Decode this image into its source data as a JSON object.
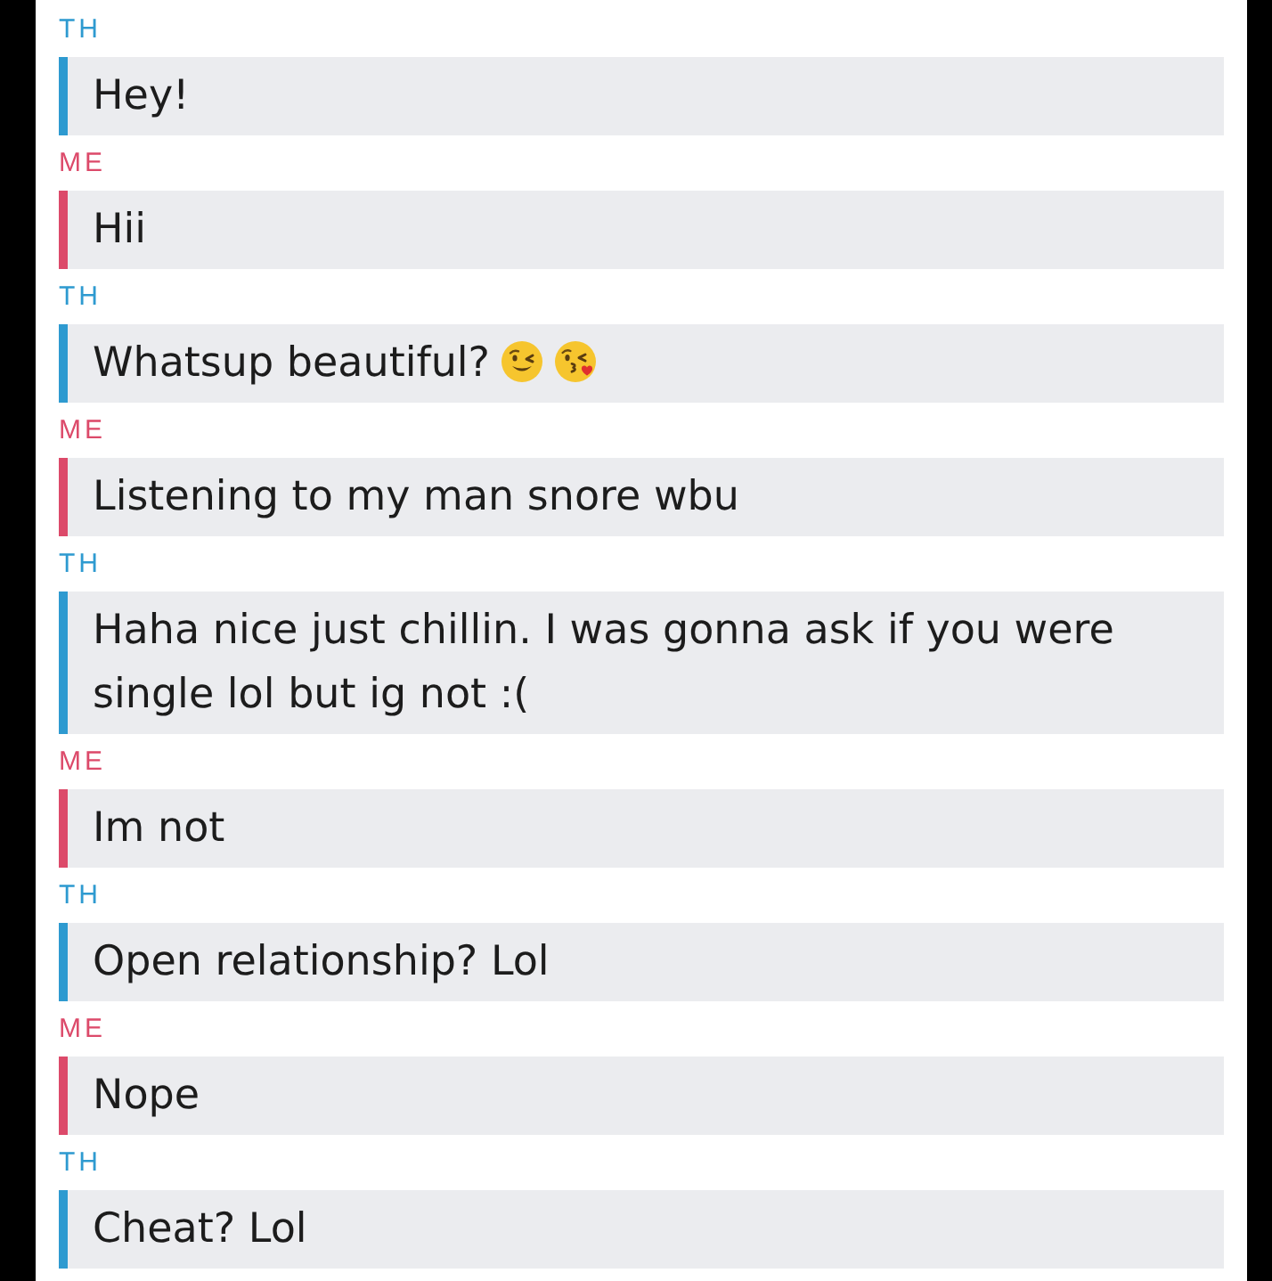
{
  "messages": [
    {
      "sender": "TH",
      "color": "#2e9ad0",
      "text": "Hey!"
    },
    {
      "sender": "ME",
      "color": "#dc4a6a",
      "text": "Hii"
    },
    {
      "sender": "TH",
      "color": "#2e9ad0",
      "text": "Whatsup beautiful?",
      "emojis": [
        {
          "kind": "wink"
        },
        {
          "kind": "kiss"
        }
      ]
    },
    {
      "sender": "ME",
      "color": "#dc4a6a",
      "text": "Listening to my man snore wbu"
    },
    {
      "sender": "TH",
      "color": "#2e9ad0",
      "text": "Haha nice just chillin. I was gonna ask if you were single lol but ig not :("
    },
    {
      "sender": "ME",
      "color": "#dc4a6a",
      "text": "Im not"
    },
    {
      "sender": "TH",
      "color": "#2e9ad0",
      "text": "Open relationship? Lol"
    },
    {
      "sender": "ME",
      "color": "#dc4a6a",
      "text": "Nope"
    },
    {
      "sender": "TH",
      "color": "#2e9ad0",
      "text": "Cheat? Lol"
    }
  ]
}
